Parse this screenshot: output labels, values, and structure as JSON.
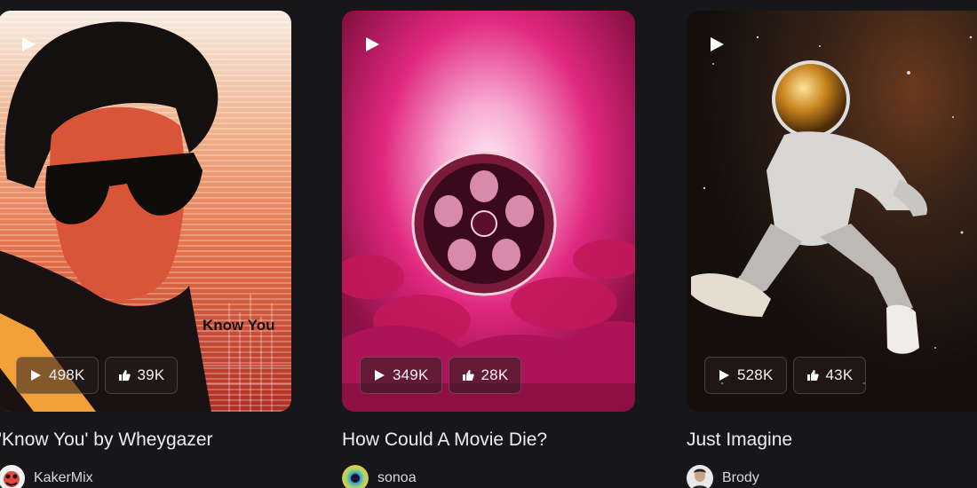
{
  "cards": [
    {
      "title": "'Know You' by Wheygazer",
      "author": "KakerMix",
      "plays": "498K",
      "likes": "39K",
      "cover_text": "Know You",
      "cover_colors": [
        "#f5e9df",
        "#e3714a",
        "#b02e25"
      ]
    },
    {
      "title": "How Could A Movie Die?",
      "author": "sonoa",
      "plays": "349K",
      "likes": "28K",
      "cover_colors": [
        "#f7a9d2",
        "#e0287e",
        "#6a0b36"
      ]
    },
    {
      "title": "Just Imagine",
      "author": "Brody",
      "plays": "528K",
      "likes": "43K",
      "cover_colors": [
        "#1a1410",
        "#3a2418",
        "#d9d7d4"
      ]
    }
  ],
  "icons": {
    "play": "play-icon",
    "like": "thumbs-up-icon"
  }
}
